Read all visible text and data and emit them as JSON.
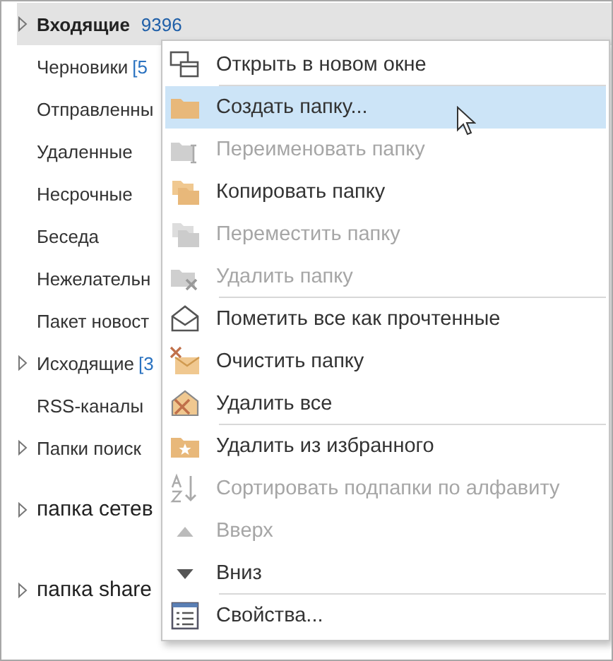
{
  "folders": [
    {
      "name": "Входящие",
      "count": "9396",
      "bold": true,
      "expandable": true,
      "selected": true,
      "kind": "folder"
    },
    {
      "name": "Черновики",
      "count": "[5",
      "bold": false,
      "expandable": false,
      "selected": false,
      "kind": "folder"
    },
    {
      "name": "Отправленны",
      "bold": false,
      "expandable": false,
      "selected": false,
      "kind": "folder"
    },
    {
      "name": "Удаленные",
      "bold": false,
      "expandable": false,
      "selected": false,
      "kind": "folder"
    },
    {
      "name": "Несрочные",
      "bold": false,
      "expandable": false,
      "selected": false,
      "kind": "folder"
    },
    {
      "name": "Беседа",
      "bold": false,
      "expandable": false,
      "selected": false,
      "kind": "folder"
    },
    {
      "name": "Нежелательн",
      "bold": false,
      "expandable": false,
      "selected": false,
      "kind": "folder"
    },
    {
      "name": "Пакет новост",
      "bold": false,
      "expandable": false,
      "selected": false,
      "kind": "folder"
    },
    {
      "name": "Исходящие",
      "count": "[3",
      "bold": false,
      "expandable": true,
      "selected": false,
      "kind": "folder"
    },
    {
      "name": "RSS-каналы",
      "bold": false,
      "expandable": false,
      "selected": false,
      "kind": "folder"
    },
    {
      "name": "Папки поиск",
      "bold": false,
      "expandable": true,
      "selected": false,
      "kind": "folder"
    },
    {
      "name": "папка сетев",
      "bold": false,
      "expandable": true,
      "selected": false,
      "kind": "account"
    },
    {
      "name": "папка share",
      "bold": false,
      "expandable": true,
      "selected": false,
      "kind": "account"
    }
  ],
  "context_menu": {
    "items": [
      {
        "label": "Открыть в новом окне",
        "disabled": false,
        "selected": false,
        "separator_after": true
      },
      {
        "label": "Создать папку...",
        "disabled": false,
        "selected": true,
        "separator_after": false
      },
      {
        "label": "Переименовать папку",
        "disabled": true,
        "selected": false,
        "separator_after": false
      },
      {
        "label": "Копировать папку",
        "disabled": false,
        "selected": false,
        "separator_after": false
      },
      {
        "label": "Переместить папку",
        "disabled": true,
        "selected": false,
        "separator_after": false
      },
      {
        "label": "Удалить папку",
        "disabled": true,
        "selected": false,
        "separator_after": true
      },
      {
        "label": "Пометить все как прочтенные",
        "disabled": false,
        "selected": false,
        "separator_after": false
      },
      {
        "label": "Очистить папку",
        "disabled": false,
        "selected": false,
        "separator_after": false
      },
      {
        "label": "Удалить все",
        "disabled": false,
        "selected": false,
        "separator_after": true
      },
      {
        "label": "Удалить из избранного",
        "disabled": false,
        "selected": false,
        "separator_after": false
      },
      {
        "label": "Сортировать подпапки по алфавиту",
        "disabled": true,
        "selected": false,
        "separator_after": false
      },
      {
        "label": "Вверх",
        "disabled": true,
        "selected": false,
        "separator_after": false
      },
      {
        "label": "Вниз",
        "disabled": false,
        "selected": false,
        "separator_after": true
      },
      {
        "label": "Свойства...",
        "disabled": false,
        "selected": false,
        "separator_after": false
      }
    ]
  }
}
